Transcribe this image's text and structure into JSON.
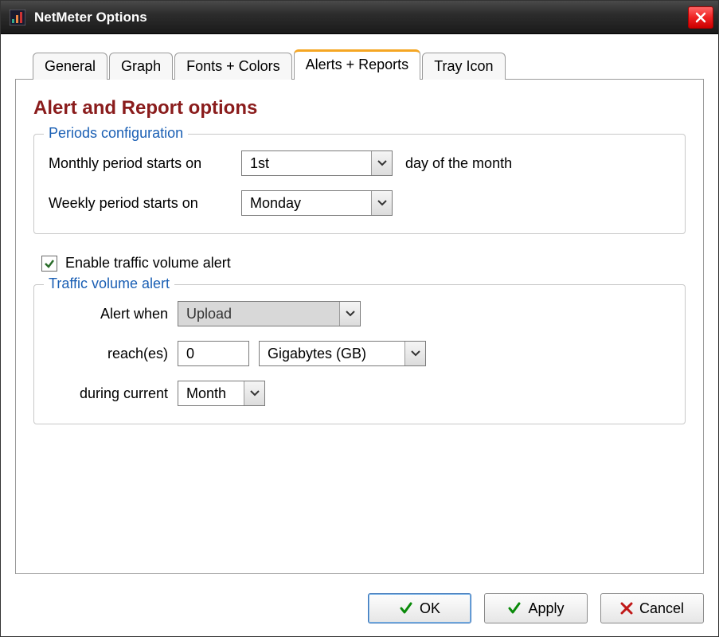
{
  "window": {
    "title": "NetMeter Options"
  },
  "tabs": [
    {
      "label": "General"
    },
    {
      "label": "Graph"
    },
    {
      "label": "Fonts + Colors"
    },
    {
      "label": "Alerts + Reports"
    },
    {
      "label": "Tray Icon"
    }
  ],
  "section": {
    "title": "Alert and Report options"
  },
  "periods": {
    "legend": "Periods configuration",
    "monthly_label": "Monthly period starts on",
    "monthly_value": "1st",
    "monthly_suffix": "day of the month",
    "weekly_label": "Weekly period starts on",
    "weekly_value": "Monday"
  },
  "enable_alert": {
    "checked": true,
    "label": "Enable traffic volume alert"
  },
  "traffic": {
    "legend": "Traffic volume alert",
    "alert_when_label": "Alert when",
    "alert_when_value": "Upload",
    "reaches_label": "reach(es)",
    "reaches_value": "0",
    "unit_value": "Gigabytes (GB)",
    "during_label": "during current",
    "during_value": "Month"
  },
  "buttons": {
    "ok": "OK",
    "apply": "Apply",
    "cancel": "Cancel"
  }
}
